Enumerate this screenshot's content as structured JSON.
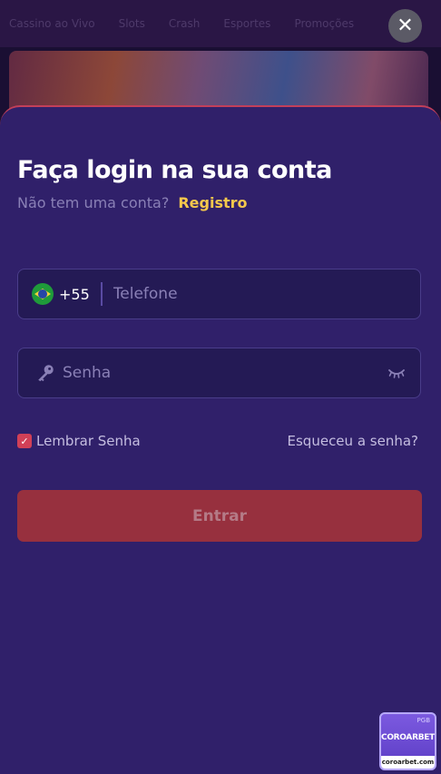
{
  "background": {
    "nav_items": [
      "Cassino ao Vivo",
      "Slots",
      "Crash",
      "Esportes",
      "Promoções"
    ]
  },
  "close_button": {
    "icon": "close-icon",
    "glyph": "✕"
  },
  "login": {
    "title": "Faça login na sua conta",
    "subtitle_text": "Não tem uma conta?",
    "register_link": "Registro",
    "phone": {
      "flag_icon": "brazil-flag-icon",
      "dial_code": "+55",
      "value": "",
      "placeholder": "Telefone"
    },
    "password": {
      "key_icon": "key-icon",
      "value": "",
      "placeholder": "Senha",
      "visibility_icon": "eye-closed-icon"
    },
    "remember": {
      "label": "Lembrar Senha",
      "checked": true
    },
    "forgot_link": "Esqueceu a senha?",
    "submit_label": "Entrar"
  },
  "badge": {
    "top_text": "PGB",
    "name": "COROARBET",
    "domain": "coroarbet.com"
  },
  "colors": {
    "modal_bg": "#30206a",
    "field_bg": "#241a55",
    "accent_link": "#f5c84c",
    "submit_bg": "#97303e",
    "checkbox": "#d14057",
    "top_border": "#c23f5a"
  }
}
